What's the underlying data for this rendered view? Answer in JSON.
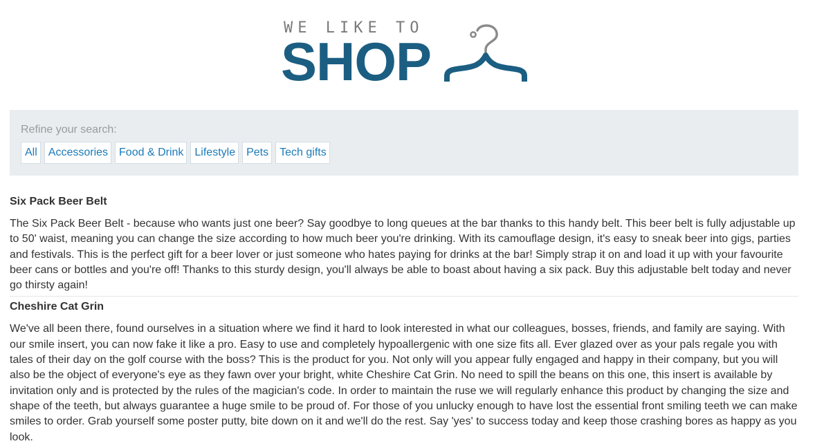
{
  "logo": {
    "tagline": "WE LIKE TO",
    "word": "SHOP",
    "hanger_icon": "coat-hanger-icon",
    "tagline_color": "#7a7a7a",
    "brand_color": "#1b5e82"
  },
  "filters": {
    "title": "Refine your search:",
    "items": [
      {
        "label": "All"
      },
      {
        "label": "Accessories"
      },
      {
        "label": "Food & Drink"
      },
      {
        "label": "Lifestyle"
      },
      {
        "label": "Pets"
      },
      {
        "label": "Tech gifts"
      }
    ],
    "link_color": "#1a7ab8",
    "panel_color": "#e9edf0"
  },
  "products": [
    {
      "title": "Six Pack Beer Belt",
      "description": "The Six Pack Beer Belt - because who wants just one beer? Say goodbye to long queues at the bar thanks to this handy belt. This beer belt is fully adjustable up to 50' waist, meaning you can change the size according to how much beer you're drinking. With its camouflage design, it's easy to sneak beer into gigs, parties and festivals. This is the perfect gift for a beer lover or just someone who hates paying for drinks at the bar! Simply strap it on and load it up with your favourite beer cans or bottles and you're off! Thanks to this sturdy design, you'll always be able to boast about having a six pack. Buy this adjustable belt today and never go thirsty again!"
    },
    {
      "title": "Cheshire Cat Grin",
      "description": "We've all been there, found ourselves in a situation where we find it hard to look interested in what our colleagues, bosses, friends, and family are saying. With our smile insert, you can now fake it like a pro. Easy to use and completely hypoallergenic with one size fits all. Ever glazed over as your pals regale you with tales of their day on the golf course with the boss? This is the product for you. Not only will you appear fully engaged and happy in their company, but you will also be the object of everyone's eye as they fawn over your bright, white Cheshire Cat Grin. No need to spill the beans on this one, this insert is available by invitation only and is protected by the rules of the magician's code. In order to maintain the ruse we will regularly enhance this product by changing the size and shape of the teeth, but always guarantee a huge smile to be proud of. For those of you unlucky enough to have lost the essential front smiling teeth we can make smiles to order. Grab yourself some poster putty, bite down on it and we'll do the rest. Say 'yes' to success today and keep those crashing bores as happy as you look."
    }
  ]
}
